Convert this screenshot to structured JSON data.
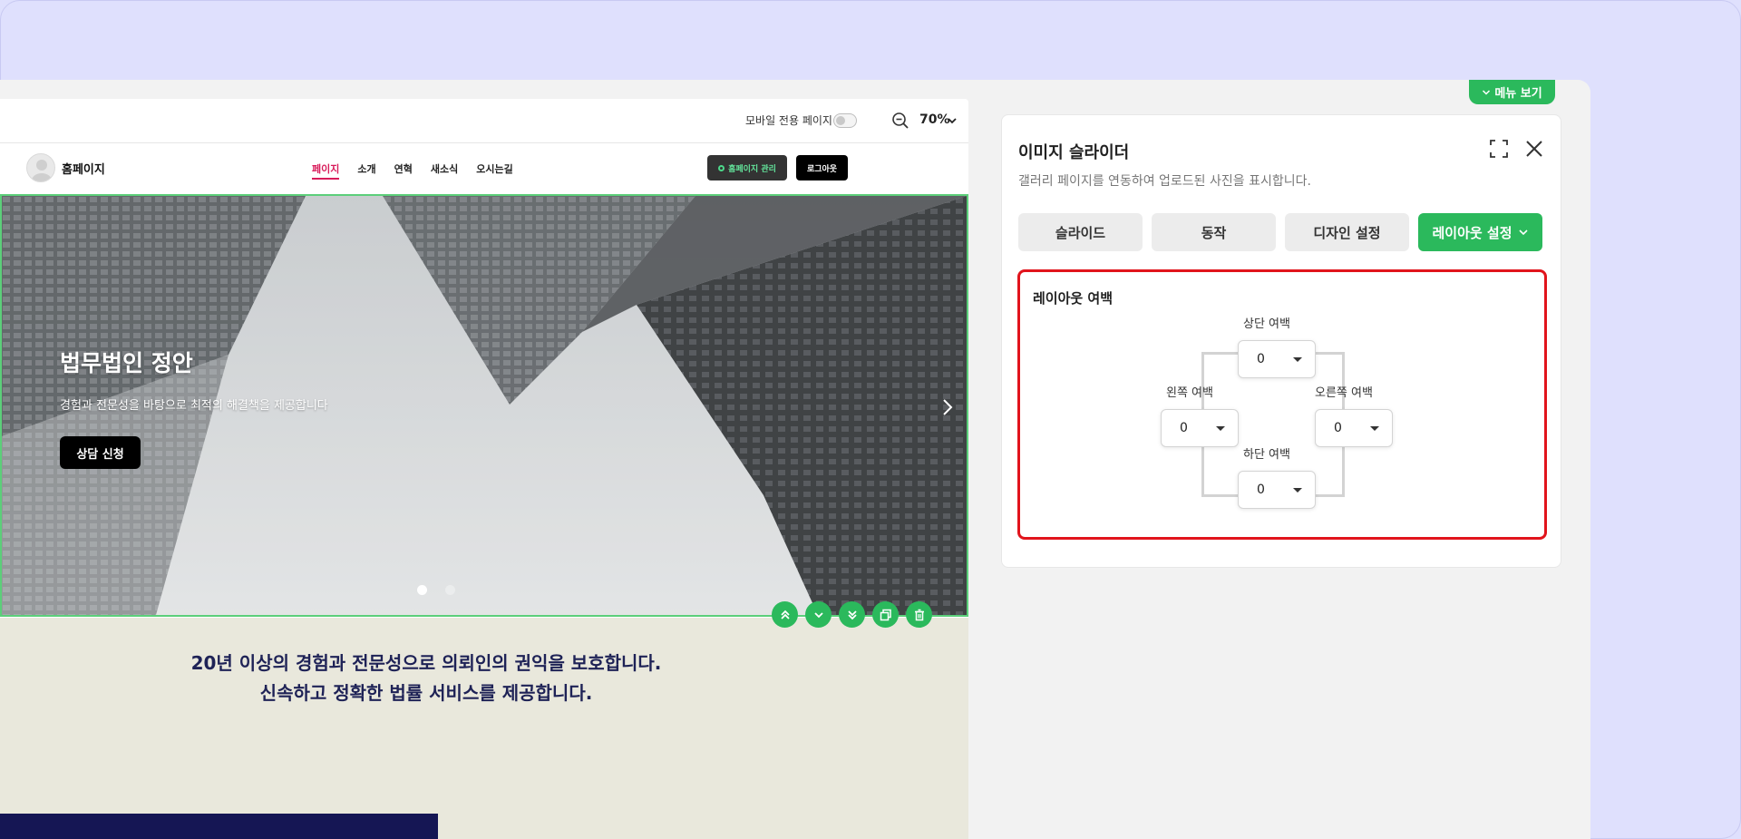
{
  "toolbar": {
    "mobile_only_label": "모바일 전용 페이지",
    "zoom_value": "70%"
  },
  "site": {
    "name": "홈페이지",
    "nav": [
      "페이지",
      "소개",
      "연혁",
      "새소식",
      "오시는길"
    ],
    "admin_label": "홈페이지 관리",
    "logout_label": "로그아웃"
  },
  "hero": {
    "title": "법무법인 정안",
    "subtitle": "경험과 전문성을 바탕으로 최적의 해결책을 제공합니다",
    "cta": "상담 신청",
    "slide_count": 2,
    "active_slide": 1
  },
  "section": {
    "line1": "20년 이상의 경험과 전문성으로 의뢰인의 권익을 보호합니다.",
    "line2": "신속하고 정확한 법률 서비스를 제공합니다."
  },
  "panel": {
    "menu_view": "메뉴 보기",
    "title": "이미지 슬라이더",
    "description": "갤러리 페이지를 연동하여 업로드된 사진을 표시합니다.",
    "tabs": {
      "slide": "슬라이드",
      "motion": "동작",
      "design": "디자인 설정",
      "layout": "레이아웃 설정"
    },
    "layout": {
      "label": "레이아웃 여백",
      "top_label": "상단 여백",
      "top_value": "0",
      "left_label": "왼쪽 여백",
      "left_value": "0",
      "right_label": "오른쪽 여백",
      "right_value": "0",
      "bottom_label": "하단 여백",
      "bottom_value": "0"
    }
  },
  "colors": {
    "accent_green": "#2bb95c",
    "highlight_red": "#e1141c",
    "navy": "#151654",
    "background": "#dfe0fd"
  }
}
